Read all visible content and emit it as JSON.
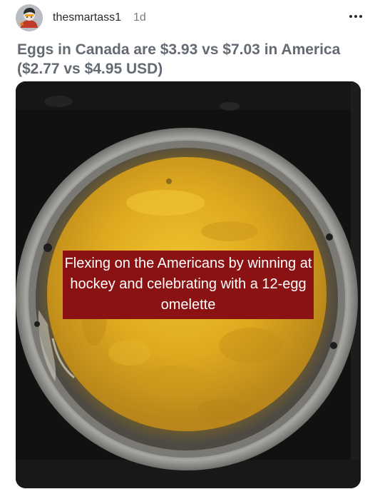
{
  "post": {
    "username": "thesmartass1",
    "timestamp": "1d",
    "title": "Eggs in Canada are $3.93 vs $7.03 in America ($2.77 vs $4.95 USD)",
    "more_icon": "ellipsis-icon",
    "avatar_icon": "avatar"
  },
  "image": {
    "subject": "omelette-in-pot",
    "caption": "Flexing on the Americans by winning at hockey and celebrating with a 12-egg omelette",
    "caption_bg": "#8b1212"
  },
  "colors": {
    "title": "#646a72",
    "egg": "#d9a51c",
    "pot_rim": "#8d8d8a"
  }
}
